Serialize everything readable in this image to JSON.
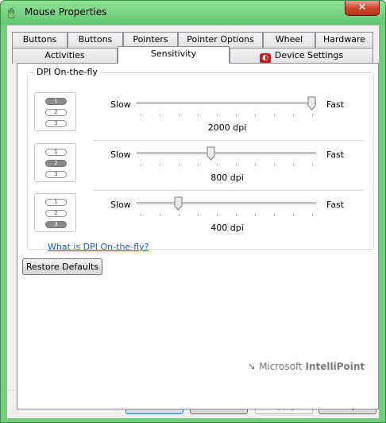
{
  "window": {
    "title": "Mouse Properties",
    "close_label": "✕"
  },
  "tabs_row1": [
    "Buttons",
    "Buttons",
    "Pointers",
    "Pointer Options",
    "Wheel",
    "Hardware"
  ],
  "tabs_row2": [
    "Activities",
    "Sensitivity",
    "Device Settings"
  ],
  "active_tab": "Sensitivity",
  "group": {
    "label": "DPI On-the-fly"
  },
  "dpi_presets": [
    {
      "pills": [
        "1",
        "2",
        "3"
      ],
      "selected": 1,
      "slow_label": "Slow",
      "fast_label": "Fast",
      "value_label": "2000 dpi",
      "slider_fraction": 1.0
    },
    {
      "pills": [
        "1",
        "2",
        "3"
      ],
      "selected": 2,
      "slow_label": "Slow",
      "fast_label": "Fast",
      "value_label": "800 dpi",
      "slider_fraction": 0.41
    },
    {
      "pills": [
        "1",
        "2",
        "3"
      ],
      "selected": 3,
      "slow_label": "Slow",
      "fast_label": "Fast",
      "value_label": "400 dpi",
      "slider_fraction": 0.22
    }
  ],
  "help_link": "What is DPI On-the-fly?",
  "restore_defaults": "Restore Defaults",
  "logo": {
    "brand": "Microsoft",
    "product": "IntelliPoint"
  },
  "buttons": {
    "ok": "OK",
    "cancel": "Cancel",
    "apply": "Apply",
    "help": "Help"
  },
  "colors": {
    "title_bar": "#6fcf7a",
    "close_button": "#c9482f",
    "link": "#1a5fb4"
  }
}
